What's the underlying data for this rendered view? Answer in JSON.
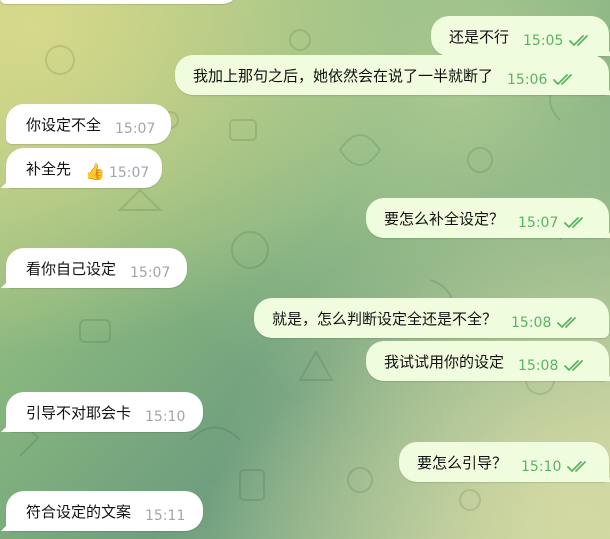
{
  "messages": [
    {
      "text": "还是不行",
      "time": "15:05"
    },
    {
      "text": "我加上那句之后，她依然会在说了一半就断了",
      "time": "15:06"
    },
    {
      "text": "你设定不全",
      "time": "15:07"
    },
    {
      "text": "补全先",
      "reaction": "👍",
      "time": "15:07"
    },
    {
      "text": "要怎么补全设定？",
      "time": "15:07"
    },
    {
      "text": "看你自己设定",
      "time": "15:07"
    },
    {
      "text": "就是，怎么判断设定全还是不全？",
      "time": "15:08"
    },
    {
      "text": "我试试用你的设定",
      "time": "15:08"
    },
    {
      "text": "引导不对耶会卡",
      "time": "15:10"
    },
    {
      "text": "要怎么引导？",
      "time": "15:10"
    },
    {
      "text": "符合设定的文案",
      "time": "15:11"
    }
  ],
  "colors": {
    "incoming_bubble": "#ffffff",
    "outgoing_bubble": "#effdde",
    "read_ticks": "#5bb461",
    "incoming_time": "#a0a6ad"
  },
  "icons": {
    "read_status": "double-check-icon",
    "reaction": "thumbs-up-icon"
  }
}
